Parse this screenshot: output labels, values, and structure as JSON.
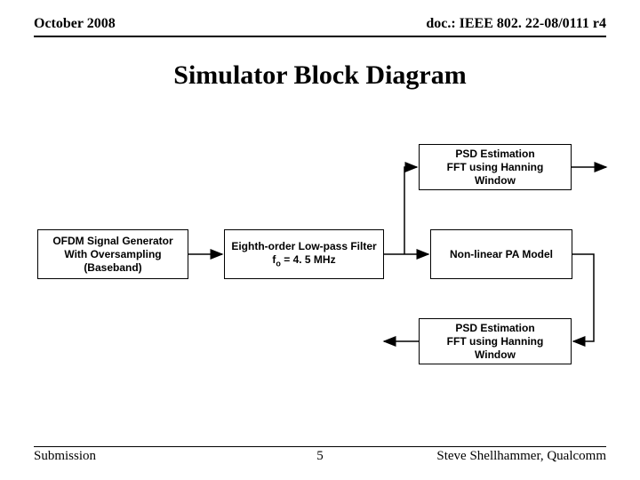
{
  "header": {
    "date": "October 2008",
    "docref": "doc.: IEEE 802. 22-08/0111 r4"
  },
  "title": "Simulator Block Diagram",
  "blocks": {
    "psd_top": "PSD Estimation\nFFT using Hanning\nWindow",
    "ofdm": "OFDM Signal Generator\nWith Oversampling\n(Baseband)",
    "lpf_line1": "Eighth-order Low-pass Filter",
    "lpf_line2_prefix": "f",
    "lpf_line2_sub": "o",
    "lpf_line2_suffix": " = 4. 5 MHz",
    "pa": "Non-linear PA Model",
    "psd_bottom": "PSD Estimation\nFFT using Hanning\nWindow"
  },
  "footer": {
    "left": "Submission",
    "center": "5",
    "right": "Steve Shellhammer, Qualcomm"
  }
}
